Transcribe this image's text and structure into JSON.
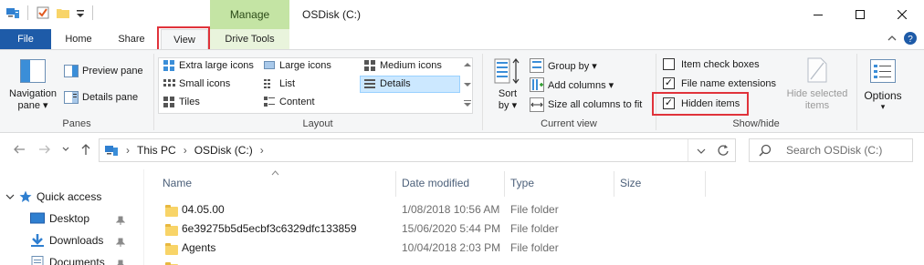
{
  "window": {
    "context_tab": "Manage",
    "title": "OSDisk (C:)",
    "controls": {
      "minimize": "—",
      "maximize": "☐",
      "close": "✕"
    }
  },
  "ribbon_tabs": {
    "file": "File",
    "home": "Home",
    "share": "Share",
    "view": "View",
    "drive_tools": "Drive Tools"
  },
  "ribbon": {
    "panes": {
      "label": "Panes",
      "navigation_pane": "Navigation",
      "navigation_pane_2": "pane ▾",
      "preview_pane": "Preview pane",
      "details_pane": "Details pane"
    },
    "layout": {
      "label": "Layout",
      "options": [
        "Extra large icons",
        "Large icons",
        "Medium icons",
        "Small icons",
        "List",
        "Details",
        "Tiles",
        "Content"
      ],
      "selected": "Details"
    },
    "current_view": {
      "label": "Current view",
      "sort_by": "Sort",
      "sort_by_2": "by ▾",
      "group_by": "Group by ▾",
      "add_columns": "Add columns ▾",
      "size_all_columns": "Size all columns to fit"
    },
    "show_hide": {
      "label": "Show/hide",
      "item_check_boxes": {
        "label": "Item check boxes",
        "checked": false
      },
      "file_name_extensions": {
        "label": "File name extensions",
        "checked": true
      },
      "hidden_items": {
        "label": "Hidden items",
        "checked": true
      },
      "hide_selected_items": "Hide selected",
      "hide_selected_items_2": "items"
    },
    "options": {
      "label": "Options",
      "arrow": "▾"
    }
  },
  "address_bar": {
    "breadcrumb": [
      "This PC",
      "OSDisk (C:)"
    ],
    "separator": "›",
    "search_placeholder": "Search OSDisk (C:)"
  },
  "nav_pane": {
    "quick_access": "Quick access",
    "items": [
      {
        "label": "Desktop",
        "icon": "desktop-icon",
        "pinned": true
      },
      {
        "label": "Downloads",
        "icon": "downloads-icon",
        "pinned": true
      },
      {
        "label": "Documents",
        "icon": "documents-icon",
        "pinned": true
      }
    ]
  },
  "file_list": {
    "columns": [
      "Name",
      "Date modified",
      "Type",
      "Size"
    ],
    "rows": [
      {
        "name": "04.05.00",
        "date": "1/08/2018 10:56 AM",
        "type": "File folder",
        "size": ""
      },
      {
        "name": "6e39275b5d5ecbf3c6329dfc133859",
        "date": "15/06/2020 5:44 PM",
        "type": "File folder",
        "size": ""
      },
      {
        "name": "Agents",
        "date": "10/04/2018 2:03 PM",
        "type": "File folder",
        "size": ""
      }
    ]
  },
  "colors": {
    "file_tab": "#1e5ba8",
    "manage_tab": "#c4e4a4",
    "highlight_box": "#e0333b",
    "selection": "#cce8ff"
  }
}
